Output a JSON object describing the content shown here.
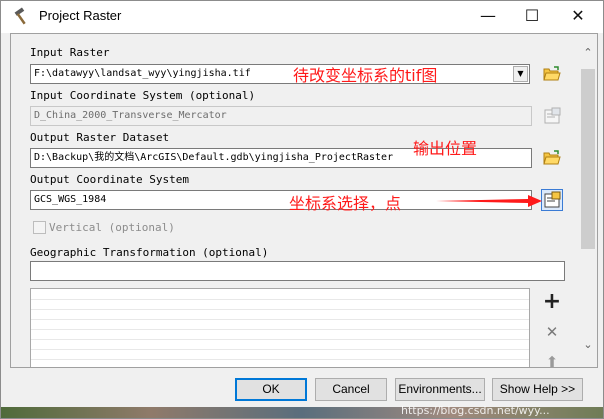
{
  "window": {
    "title": "Project Raster",
    "minimize_glyph": "—",
    "maximize_glyph": "☐",
    "close_glyph": "✕"
  },
  "form": {
    "input_raster": {
      "label": "Input Raster",
      "value": "F:\\datawyy\\landsat_wyy\\yingjisha.tif",
      "icon": "folder-open-icon"
    },
    "input_coordinate_system": {
      "label": "Input Coordinate System (optional)",
      "value": "D_China_2000_Transverse_Mercator",
      "icon": "coordinate-properties-icon"
    },
    "output_raster_dataset": {
      "label": "Output Raster Dataset",
      "value": "D:\\Backup\\我的文档\\ArcGIS\\Default.gdb\\yingjisha_ProjectRaster",
      "icon": "folder-open-icon"
    },
    "output_coordinate_system": {
      "label": "Output Coordinate System",
      "value": "GCS_WGS_1984",
      "icon": "coordinate-properties-icon"
    },
    "vertical": {
      "label": "Vertical (optional)",
      "checked": false
    },
    "geographic_transformation": {
      "label": "Geographic Transformation (optional)",
      "value": ""
    }
  },
  "annotations": {
    "input_note": "待改变坐标系的tif图",
    "output_note": "输出位置",
    "coord_note": "坐标系选择，点"
  },
  "list_actions": {
    "add_glyph": "+",
    "remove_glyph": "✕",
    "up_glyph": "⬆"
  },
  "scrollbar": {
    "up_glyph": "⌃",
    "down_glyph": "⌄"
  },
  "buttons": {
    "ok": "OK",
    "cancel": "Cancel",
    "environments": "Environments...",
    "show_help": "Show Help >>"
  },
  "watermark": "https://blog.csdn.net/wyy...",
  "colors": {
    "annotation": "#ff1a1a",
    "folder": "#f5c542",
    "accent": "#0078d7"
  }
}
